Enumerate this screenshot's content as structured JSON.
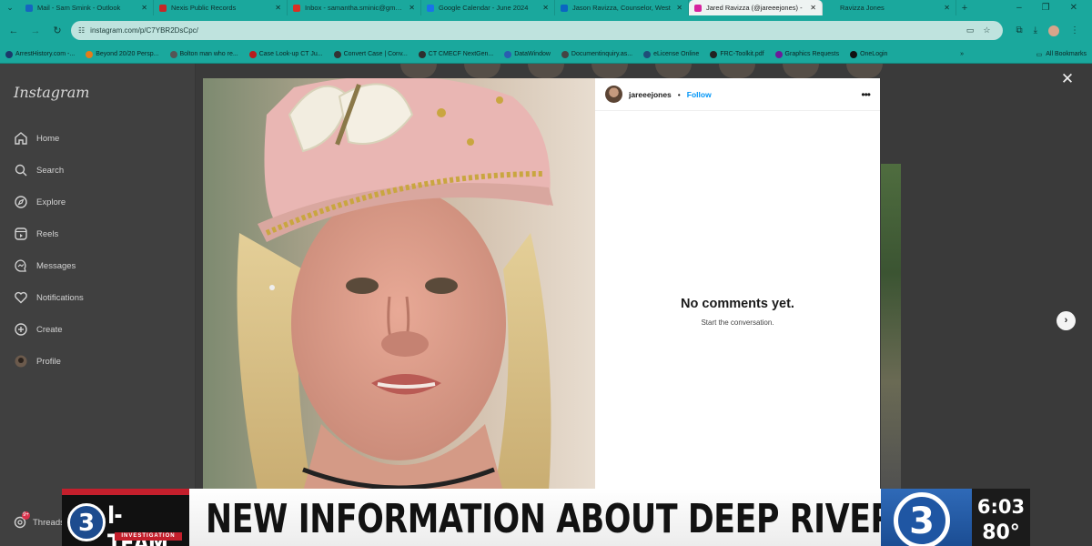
{
  "browser": {
    "tabs": [
      {
        "title": "Mail - Sam Smink - Outlook",
        "favicon_color": "#1565c0"
      },
      {
        "title": "Nexis Public Records",
        "favicon_color": "#c62828"
      },
      {
        "title": "Inbox - samantha.sminic@gmail.com",
        "favicon_color": "#d93025"
      },
      {
        "title": "Google Calendar - June 2024",
        "favicon_color": "#1a73e8"
      },
      {
        "title": "Jason Ravizza, Counselor, West",
        "favicon_color": "#0a66c2"
      },
      {
        "title": "Jared Ravizza (@jareeejones) -",
        "favicon_color": "#d6249f"
      },
      {
        "title": "Ravizza Jones",
        "favicon_color": ""
      }
    ],
    "active_tab_index": 5,
    "url": "instagram.com/p/C7YBR2DsCpc/",
    "bookmarks": [
      {
        "label": "ArrestHistory.com -...",
        "color": "#1b3a6b"
      },
      {
        "label": "Beyond 20/20 Persp...",
        "color": "#e37d1a"
      },
      {
        "label": "Bolton man who re...",
        "color": "#555555"
      },
      {
        "label": "Case Look-up CT Ju...",
        "color": "#b71c1c"
      },
      {
        "label": "Convert Case | Conv...",
        "color": "#333333"
      },
      {
        "label": "CT CMECF NextGen...",
        "color": "#2e2e2e"
      },
      {
        "label": "DataWindow",
        "color": "#2a5db0"
      },
      {
        "label": "Documentinquiry.as...",
        "color": "#444444"
      },
      {
        "label": "eLicense Online",
        "color": "#1f4e79"
      },
      {
        "label": "FRC-Toolkit.pdf",
        "color": "#222222"
      },
      {
        "label": "Graphics Requests",
        "color": "#6a1b9a"
      },
      {
        "label": "OneLogin",
        "color": "#111111"
      }
    ],
    "all_bookmarks": "All Bookmarks"
  },
  "instagram": {
    "logo": "Instagram",
    "nav": [
      {
        "label": "Home",
        "icon": "home-icon"
      },
      {
        "label": "Search",
        "icon": "search-icon"
      },
      {
        "label": "Explore",
        "icon": "compass-icon"
      },
      {
        "label": "Reels",
        "icon": "reels-icon"
      },
      {
        "label": "Messages",
        "icon": "messenger-icon"
      },
      {
        "label": "Notifications",
        "icon": "heart-icon"
      },
      {
        "label": "Create",
        "icon": "plus-square-icon"
      },
      {
        "label": "Profile",
        "icon": "avatar-icon"
      }
    ],
    "threads_label": "Threads",
    "threads_badge": "9+"
  },
  "post": {
    "username": "jareeejones",
    "separator": "•",
    "follow_label": "Follow",
    "more_label": "•••",
    "no_comments_title": "No comments yet.",
    "no_comments_sub": "Start the conversation."
  },
  "broadcast": {
    "channel_number": "3",
    "brand": "I-TEAM",
    "brand_sub": "INVESTIGATION",
    "headline": "NEW INFORMATION ABOUT DEEP RIVER SUSPECT",
    "time": "6:03",
    "temperature": "80°"
  },
  "colors": {
    "browser_frame": "#1aa89d",
    "instagram_link": "#0095f6",
    "news_red": "#c41f2c",
    "news_blue": "#1f56a3"
  }
}
